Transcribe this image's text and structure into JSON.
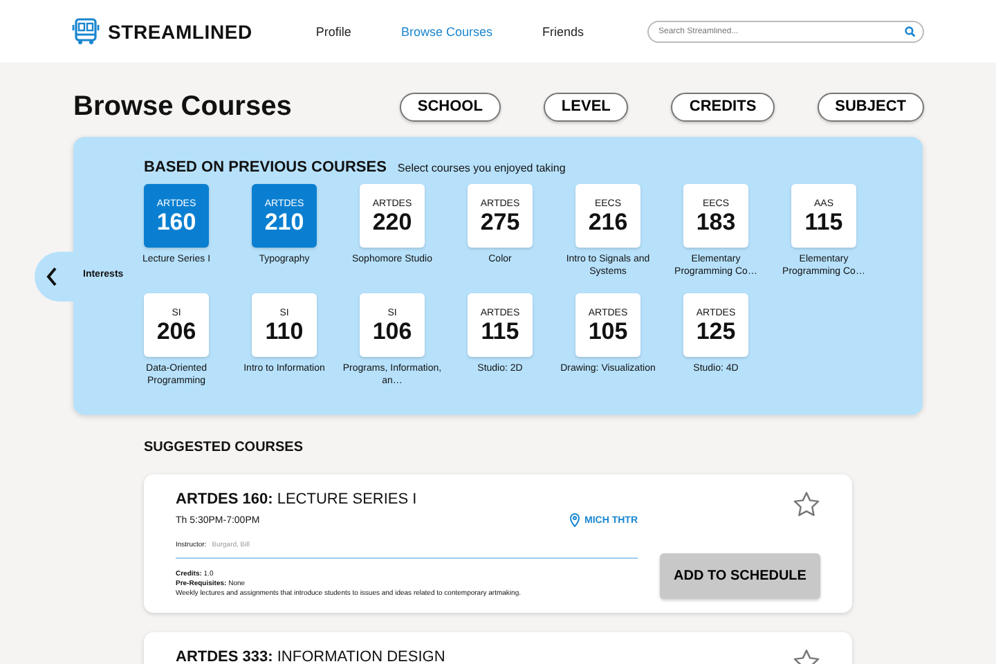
{
  "header": {
    "brand": "STREAMLINED",
    "nav": [
      {
        "label": "Profile",
        "selected": false
      },
      {
        "label": "Browse Courses",
        "selected": true
      },
      {
        "label": "Friends",
        "selected": false
      }
    ],
    "search": {
      "placeholder": "Search Streamlined..."
    }
  },
  "title": "Browse Courses",
  "filters": [
    "SCHOOL",
    "LEVEL",
    "CREDITS",
    "SUBJECT"
  ],
  "side_tab": {
    "label": "Interests"
  },
  "previous": {
    "heading": "BASED ON PREVIOUS COURSES",
    "hint": "Select courses you enjoyed taking",
    "rows": [
      [
        {
          "dept": "ARTDES",
          "number": "160",
          "name": "Lecture Series I",
          "selected": true
        },
        {
          "dept": "ARTDES",
          "number": "210",
          "name": "Typography",
          "selected": true
        },
        {
          "dept": "ARTDES",
          "number": "220",
          "name": "Sophomore Studio",
          "selected": false
        },
        {
          "dept": "ARTDES",
          "number": "275",
          "name": "Color",
          "selected": false
        },
        {
          "dept": "EECS",
          "number": "216",
          "name": "Intro to Signals and Systems",
          "selected": false
        },
        {
          "dept": "EECS",
          "number": "183",
          "name": "Elementary Programming Co…",
          "selected": false
        },
        {
          "dept": "AAS",
          "number": "115",
          "name": "Elementary Programming Co…",
          "selected": false
        }
      ],
      [
        {
          "dept": "SI",
          "number": "206",
          "name": "Data-Oriented Programming",
          "selected": false
        },
        {
          "dept": "SI",
          "number": "110",
          "name": "Intro to Information",
          "selected": false
        },
        {
          "dept": "SI",
          "number": "106",
          "name": "Programs, Information, an…",
          "selected": false
        },
        {
          "dept": "ARTDES",
          "number": "115",
          "name": "Studio: 2D",
          "selected": false
        },
        {
          "dept": "ARTDES",
          "number": "105",
          "name": "Drawing: Visualization",
          "selected": false
        },
        {
          "dept": "ARTDES",
          "number": "125",
          "name": "Studio: 4D",
          "selected": false
        }
      ]
    ]
  },
  "suggested": {
    "heading": "SUGGESTED COURSES",
    "courses": [
      {
        "title": "**ARTDES 160:** LECTURE SERIES I",
        "time": "Th 5:30PM-7:00PM",
        "location": "MICH THTR",
        "instructor_label": "Instructor:",
        "instructor": "Burgard, Bill",
        "credits": "**Credits:** 1.0",
        "prereqs": "**Pre-Requisites:** None",
        "description": "Weekly lectures and assignments that introduce students to issues and ideas related to contemporary artmaking.",
        "button": "ADD TO SCHEDULE"
      },
      {
        "title": "**ARTDES 333:** INFORMATION DESIGN"
      }
    ]
  }
}
